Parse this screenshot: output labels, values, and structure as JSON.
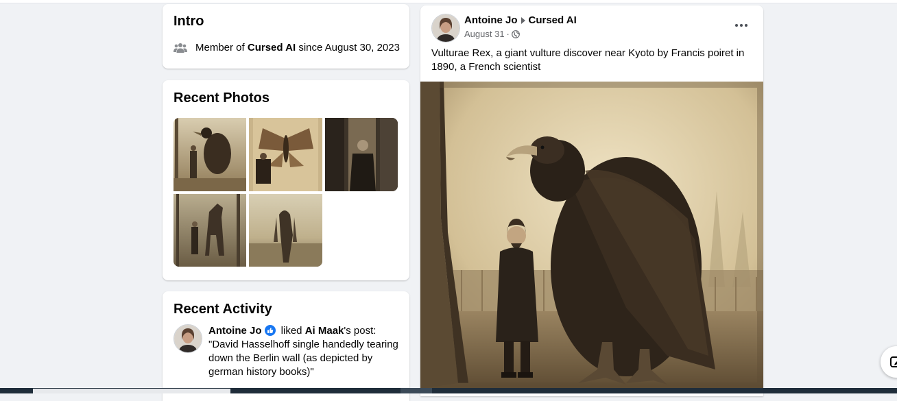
{
  "intro": {
    "title": "Intro",
    "member_prefix": "Member of ",
    "group_name": "Cursed AI",
    "member_suffix": " since August 30, 2023"
  },
  "photos": {
    "title": "Recent Photos",
    "items": [
      {
        "desc": "giant bird with man"
      },
      {
        "desc": "giant moth with man"
      },
      {
        "desc": "man in dark alley"
      },
      {
        "desc": "tall creature in forest"
      },
      {
        "desc": "hairy figure in field"
      }
    ]
  },
  "activity": {
    "title": "Recent Activity",
    "user": "Antoine Jo",
    "action": " liked ",
    "target": "Ai Maak",
    "possessive": "'s post:",
    "quote": "\"David Hasselhoff single handedly tearing down the Berlin wall (as depicted by german history books)\""
  },
  "post": {
    "author": "Antoine Jo",
    "group": "Cursed AI",
    "date": "August 31",
    "separator": "·",
    "text": "Vulturae Rex, a giant vulture discover near Kyoto by Francis poiret in 1890, a French scientist"
  },
  "icons": {
    "members": "people-icon",
    "verified": "verified-badge-icon",
    "globe": "globe-icon",
    "more": "more-horizontal-icon",
    "edit": "compose-icon"
  },
  "colors": {
    "background": "#f0f2f5",
    "card": "#ffffff",
    "secondary_text": "#65676b",
    "badge_blue": "#1877f2",
    "sepia": "#b39b6e"
  }
}
